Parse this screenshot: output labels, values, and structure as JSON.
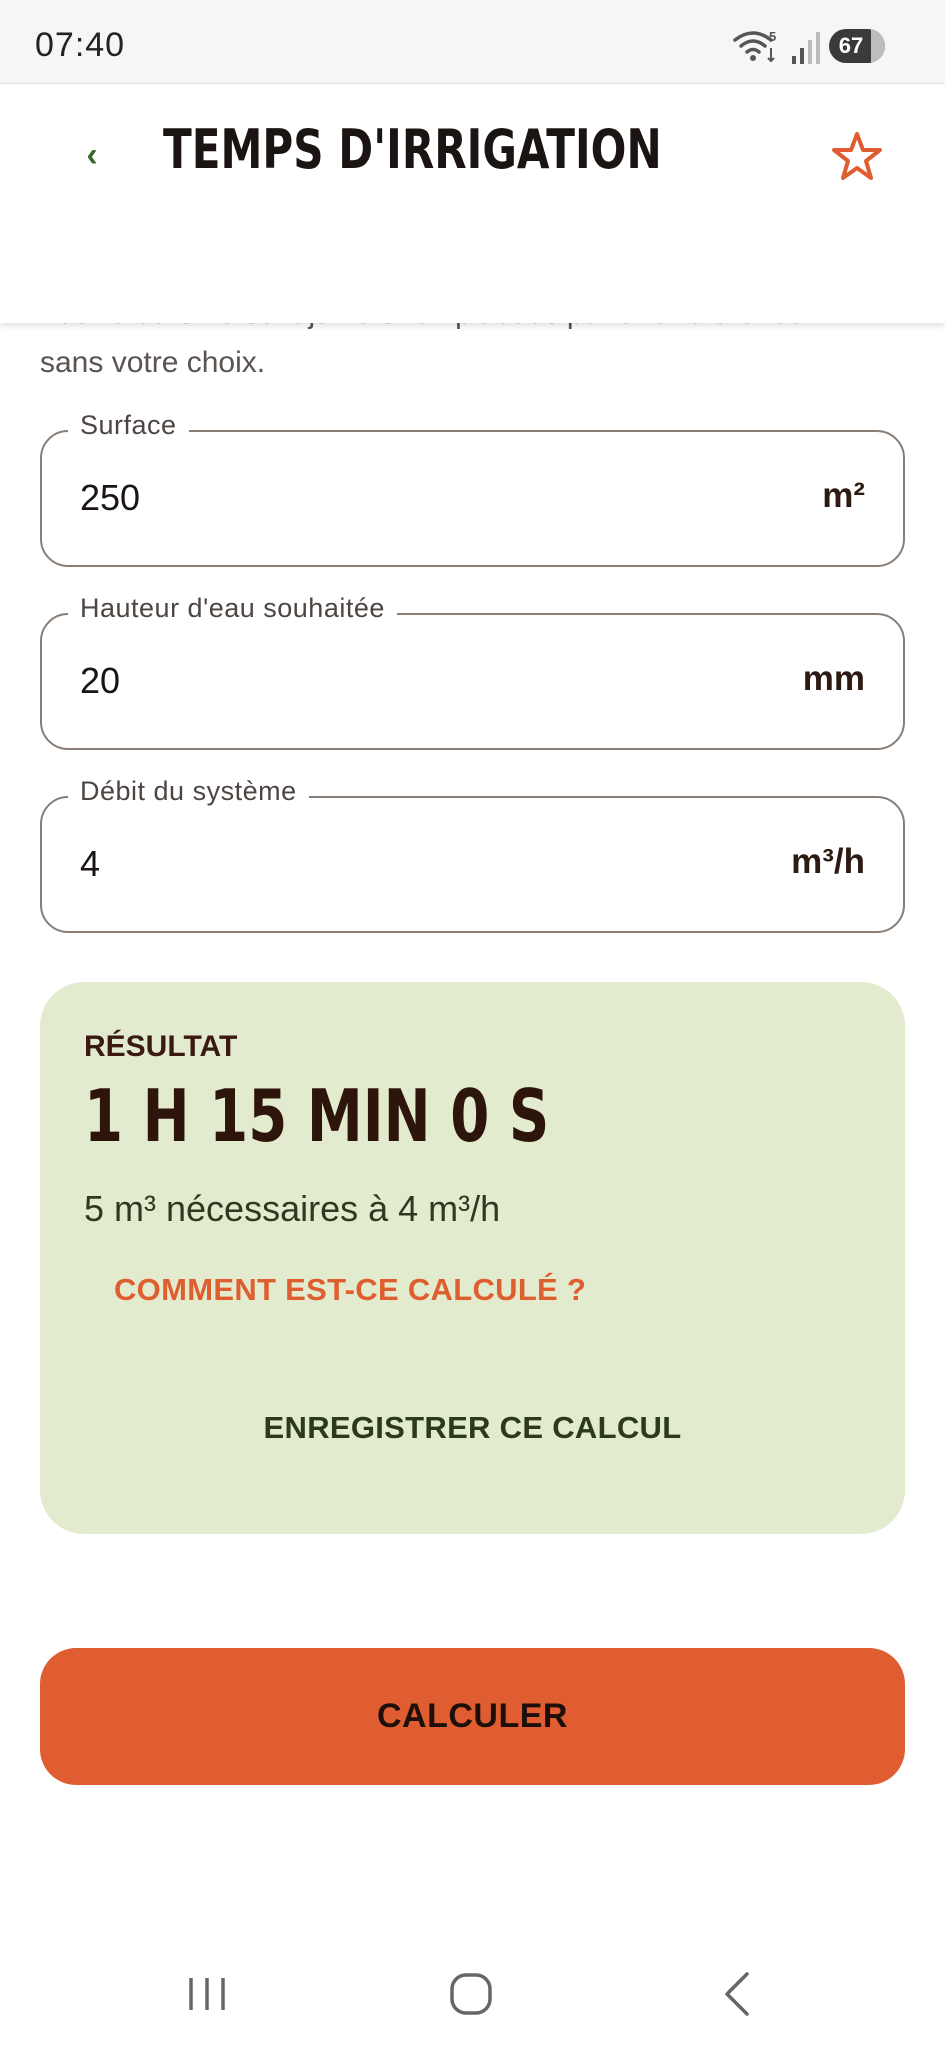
{
  "status_bar": {
    "time": "07:40",
    "wifi_badge": "5",
    "battery_level": "67"
  },
  "header": {
    "back_glyph": "‹",
    "title": "TEMPS D'IRRIGATION"
  },
  "intro": {
    "partial_text": "Les valeurs ne sont jamais remplacées par une référence",
    "text": "sans votre choix."
  },
  "fields": [
    {
      "label": "Surface",
      "value": "250",
      "unit": "m²"
    },
    {
      "label": "Hauteur d'eau souhaitée",
      "value": "20",
      "unit": "mm"
    },
    {
      "label": "Débit du système",
      "value": "4",
      "unit": "m³/h"
    }
  ],
  "result": {
    "label": "RÉSULTAT",
    "value": "1 H 15 MIN 0 S",
    "detail": "5 m³ nécessaires à 4 m³/h",
    "how_link": "COMMENT EST-CE CALCULÉ ?",
    "save_label": "ENREGISTRER CE CALCUL"
  },
  "calc_button": "CALCULER",
  "colors": {
    "accent": "#df5d31",
    "card_bg": "#e2ebcd",
    "back_arrow": "#3c6a2c"
  },
  "icons": [
    "back-icon",
    "star-icon",
    "wifi-icon",
    "signal-icon",
    "battery-icon",
    "nav-recents-icon",
    "nav-home-icon",
    "nav-back-icon"
  ]
}
